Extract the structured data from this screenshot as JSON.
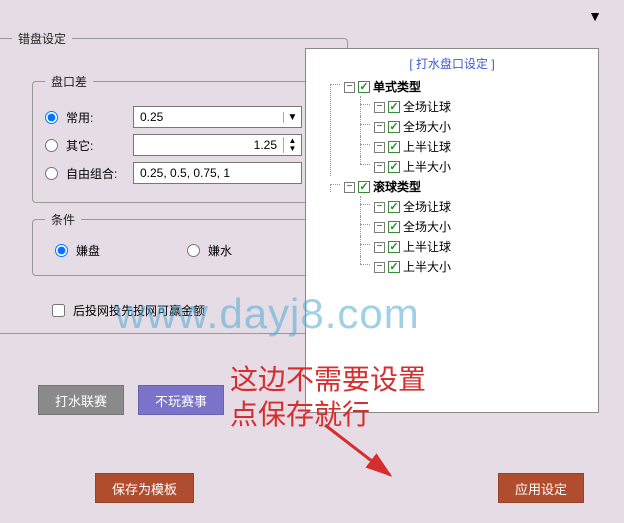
{
  "fieldsets": {
    "wrong_title": "错盘设定",
    "diff_title": "盘口差",
    "cond_title": "条件"
  },
  "diff": {
    "opt_common": "常用:",
    "opt_other": "其它:",
    "opt_free": "自由组合:",
    "common_value": "0.25",
    "other_value": "1.25",
    "free_value": "0.25, 0.5, 0.75, 1"
  },
  "cond": {
    "opt_pan": "嫌盘",
    "opt_water": "嫌水"
  },
  "checkbox_label": "后投网投先投网可赢金额",
  "buttons": {
    "match": "打水联赛",
    "skip": "不玩赛事",
    "save_tpl": "保存为模板",
    "apply": "应用设定"
  },
  "tree": {
    "title": "[ 打水盘口设定 ]",
    "g1": "单式类型",
    "g2": "滚球类型",
    "i1": "全场让球",
    "i2": "全场大小",
    "i3": "上半让球",
    "i4": "上半大小"
  },
  "watermark": "www.dayj8.com",
  "annotation_l1": "这边不需要设置",
  "annotation_l2": "点保存就行"
}
